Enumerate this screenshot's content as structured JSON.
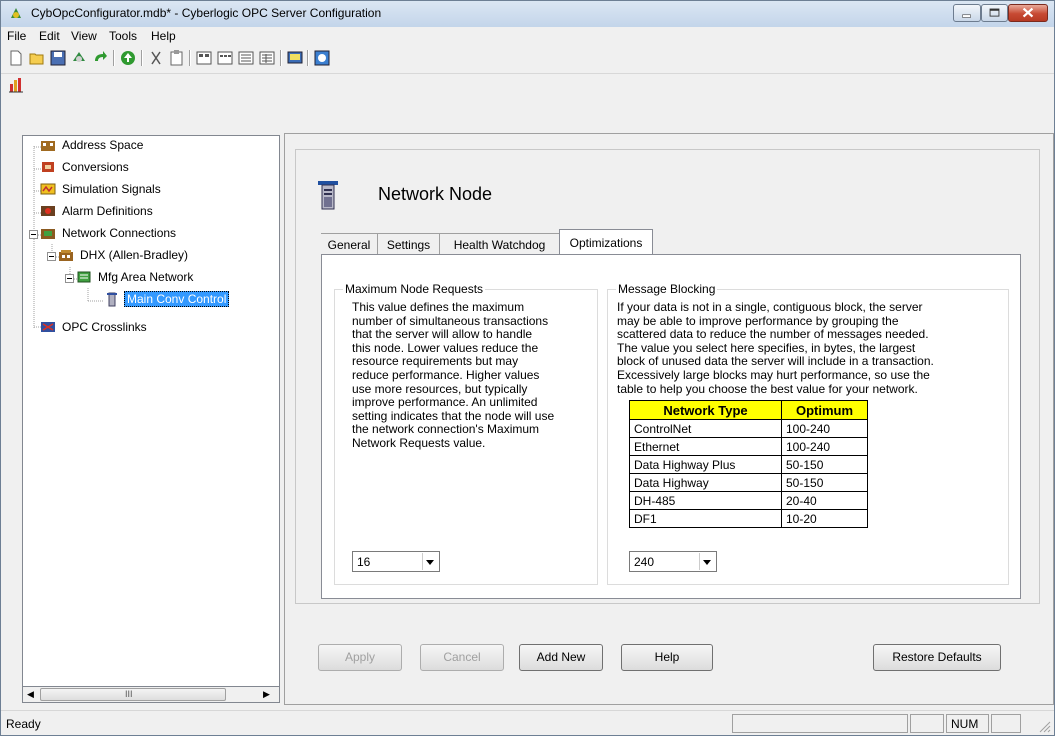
{
  "window": {
    "title": "CybOpcConfigurator.mdb* - Cyberlogic OPC Server Configuration"
  },
  "menu": {
    "items": [
      "File",
      "Edit",
      "View",
      "Tools",
      "Help"
    ]
  },
  "toolbar": {
    "buttons": [
      "new-icon",
      "open-folder-icon",
      "save-icon",
      "link-icon",
      "undo-icon",
      "upload-icon",
      "cut-icon",
      "paste-icon",
      "view-large-icon",
      "view-small-icon",
      "view-list-icon",
      "view-details-icon",
      "monitor-icon",
      "help-icon"
    ],
    "toolbar2_buttons": [
      "chart-icon"
    ]
  },
  "tree": {
    "items": [
      {
        "label": "Address Space",
        "icon": "address-space-icon"
      },
      {
        "label": "Conversions",
        "icon": "conversions-icon"
      },
      {
        "label": "Simulation Signals",
        "icon": "simulation-icon"
      },
      {
        "label": "Alarm Definitions",
        "icon": "alarm-icon"
      },
      {
        "label": "Network Connections",
        "icon": "network-connections-icon"
      },
      {
        "label": "DHX (Allen-Bradley)",
        "icon": "dhx-icon"
      },
      {
        "label": "Mfg Area Network",
        "icon": "network-icon"
      },
      {
        "label": "Main Conv Control",
        "icon": "node-icon"
      },
      {
        "label": "OPC Crosslinks",
        "icon": "crosslinks-icon"
      }
    ],
    "scroll_label": "III"
  },
  "panel": {
    "title": "Network Node",
    "tabs": [
      "General",
      "Settings",
      "Health Watchdog",
      "Optimizations"
    ],
    "active_tab": "Optimizations",
    "max_node_requests": {
      "legend": "Maximum Node Requests",
      "lines": [
        "This value defines the maximum",
        "number of simultaneous transactions",
        "that the server will allow to handle",
        "this node. Lower values reduce the",
        "resource requirements but may",
        "reduce performance. Higher values",
        "use more resources, but typically",
        "improve performance. An unlimited",
        "setting indicates that the node will use",
        "the network connection's Maximum",
        "Network Requests value."
      ],
      "value": "16"
    },
    "message_blocking": {
      "legend": "Message Blocking",
      "lines": [
        "If your data is not in a single, contiguous block, the server",
        "may be able to improve performance by grouping the",
        "scattered data to reduce the number of messages needed.",
        "The value you select here specifies, in bytes, the largest",
        "block of unused data the server will include in a transaction.",
        "Excessively large blocks may hurt performance, so use the",
        "table to help you choose the best value for your network."
      ],
      "table": {
        "headers": [
          "Network Type",
          "Optimum"
        ],
        "rows": [
          [
            "ControlNet",
            "100-240"
          ],
          [
            "Ethernet",
            "100-240"
          ],
          [
            "Data Highway Plus",
            "50-150"
          ],
          [
            "Data Highway",
            "50-150"
          ],
          [
            "DH-485",
            "20-40"
          ],
          [
            "DF1",
            "10-20"
          ]
        ]
      },
      "value": "240"
    },
    "buttons": {
      "apply": "Apply",
      "cancel": "Cancel",
      "add_new": "Add New",
      "help": "Help",
      "restore_defaults": "Restore Defaults"
    }
  },
  "status": {
    "text": "Ready",
    "num": "NUM"
  }
}
